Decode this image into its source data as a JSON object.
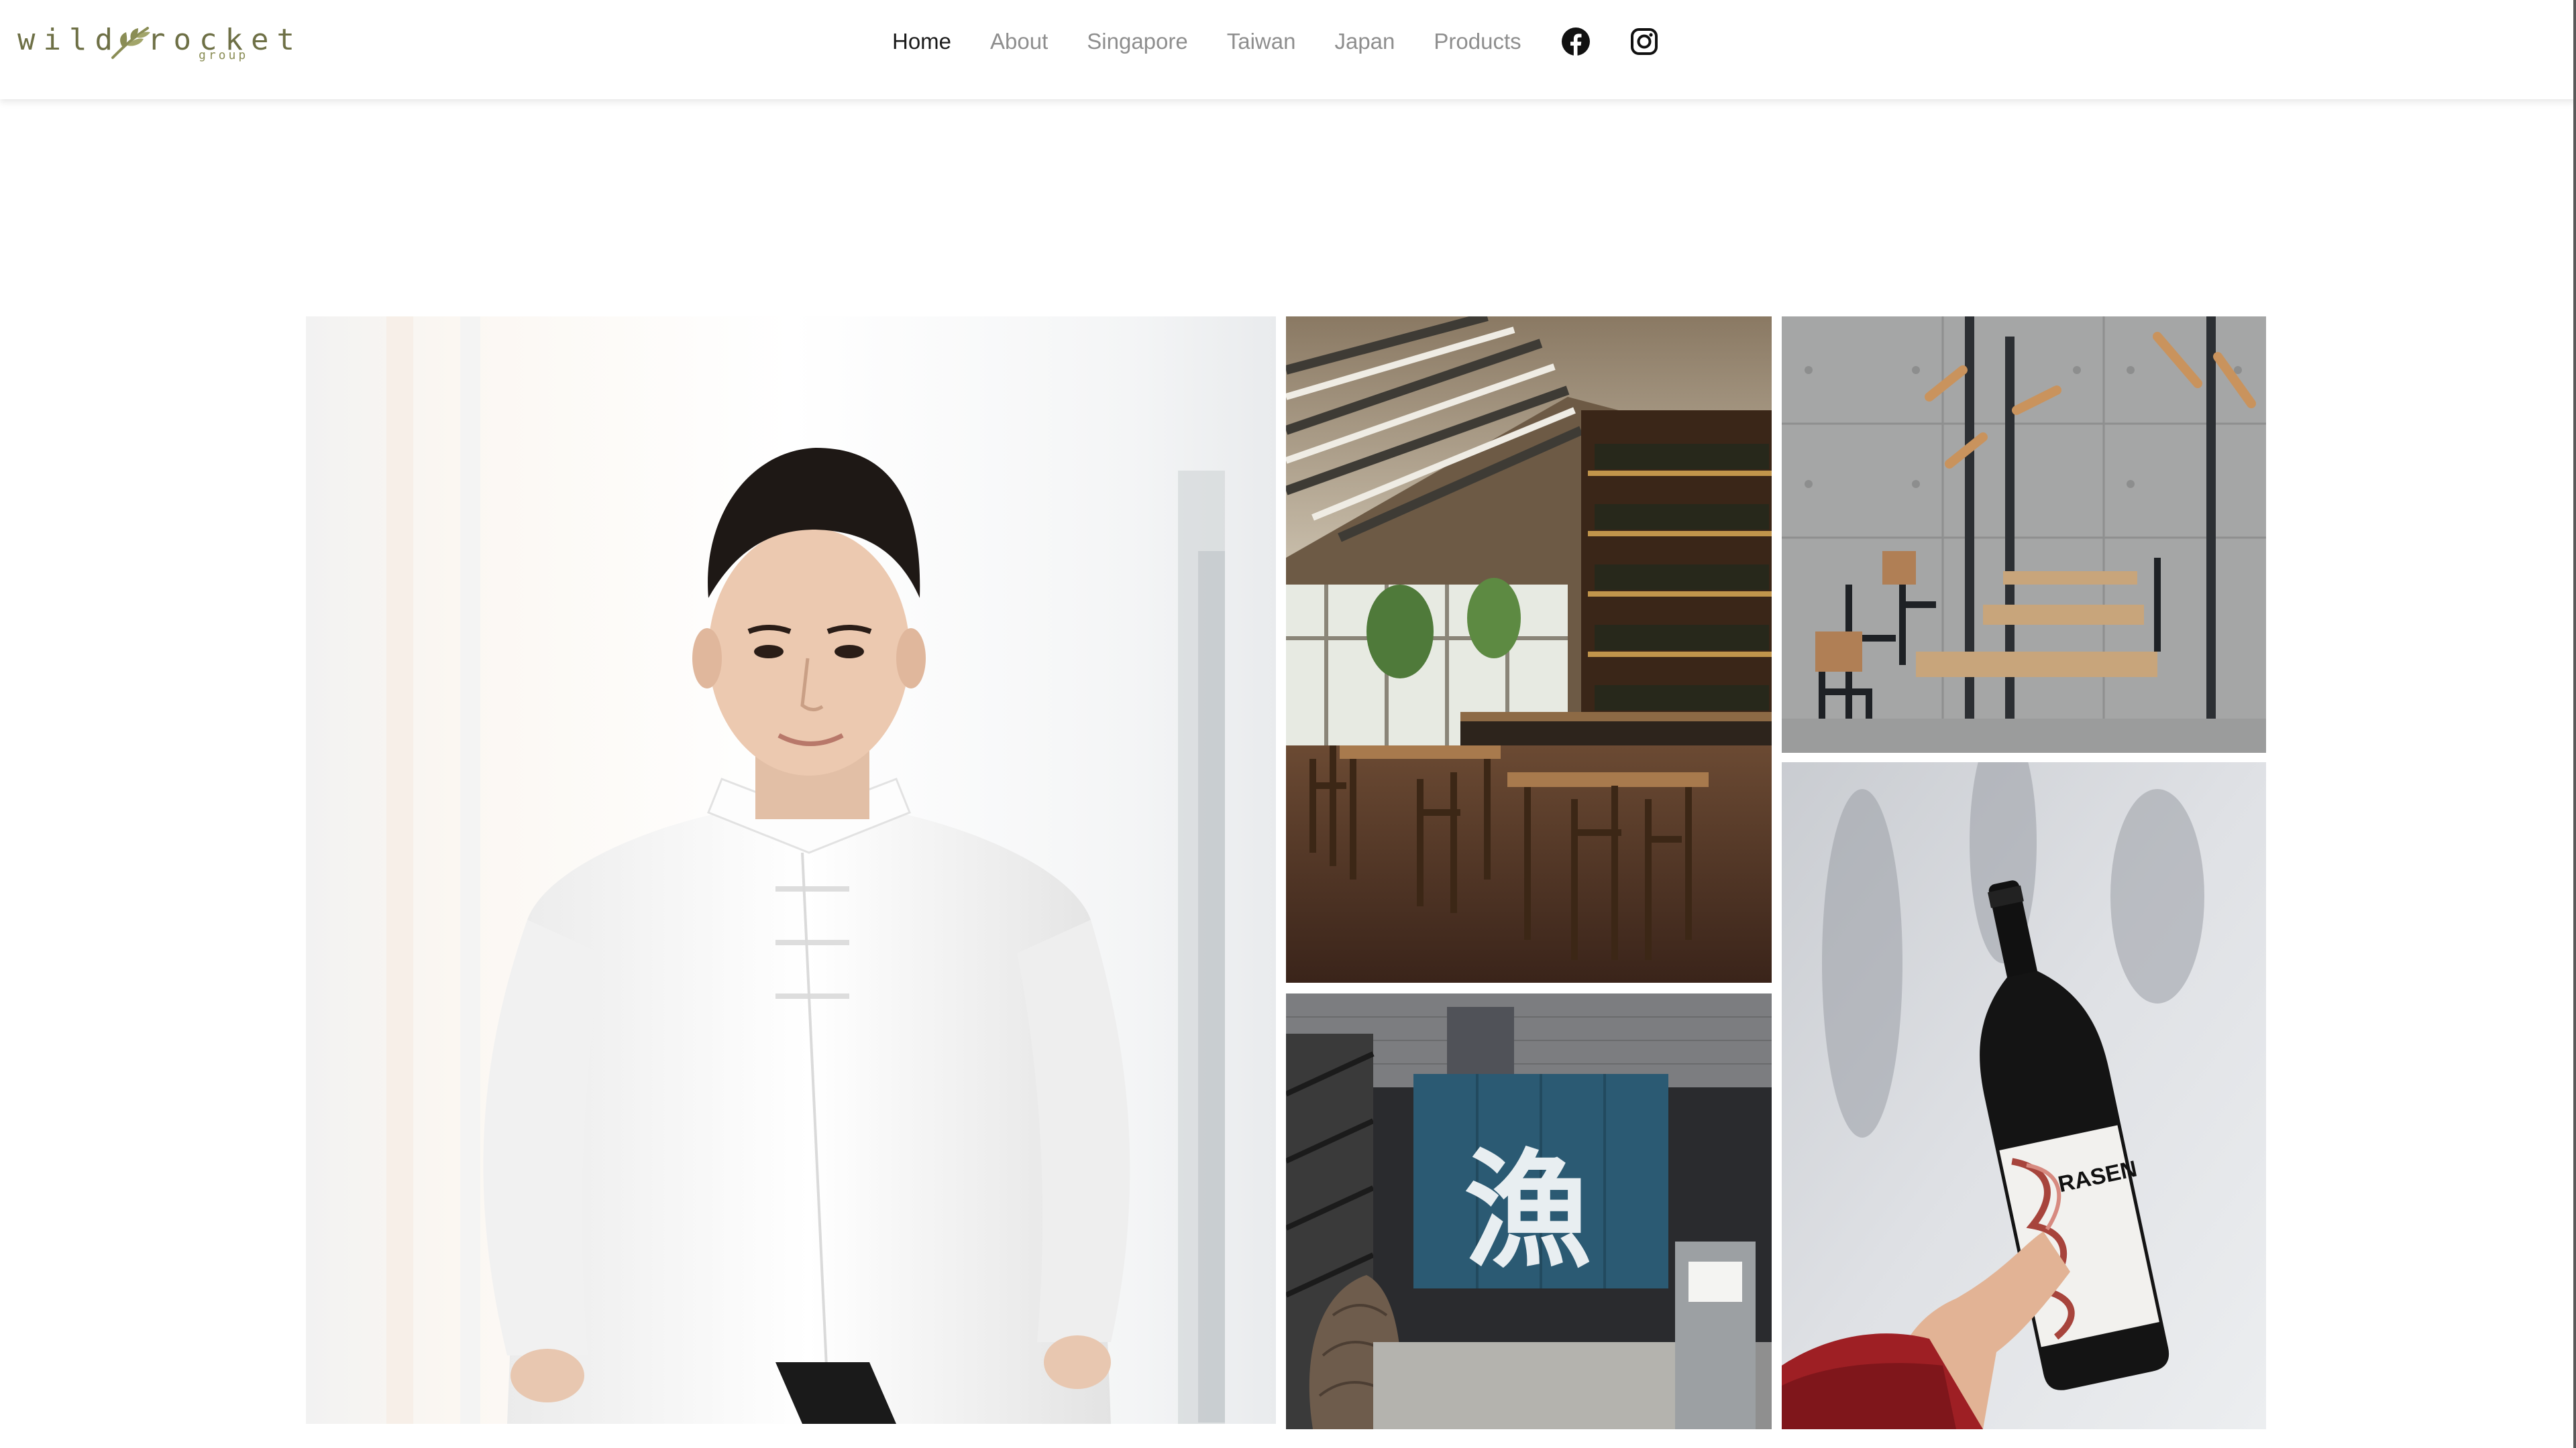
{
  "brand": {
    "name_part1": "wild",
    "name_part2": "rocket",
    "sub": "group"
  },
  "nav": {
    "items": [
      {
        "label": "Home",
        "active": true
      },
      {
        "label": "About",
        "active": false
      },
      {
        "label": "Singapore",
        "active": false
      },
      {
        "label": "Taiwan",
        "active": false
      },
      {
        "label": "Japan",
        "active": false
      },
      {
        "label": "Products",
        "active": false
      }
    ],
    "social": [
      {
        "icon": "facebook-icon"
      },
      {
        "icon": "instagram-icon"
      }
    ]
  },
  "gallery": {
    "tiles": [
      {
        "subject": "chef-portrait"
      },
      {
        "subject": "restaurant-interior-bar"
      },
      {
        "subject": "cafe-chairs-tables"
      },
      {
        "subject": "storefront-noren"
      },
      {
        "subject": "sake-bottle-snow"
      }
    ],
    "noren_glyph": "漁",
    "bottle_label": "RASEN"
  },
  "colors": {
    "brand_olive": "#6e7046",
    "nav_active": "#1a1a1a",
    "nav_inactive": "#8e8e8e"
  }
}
